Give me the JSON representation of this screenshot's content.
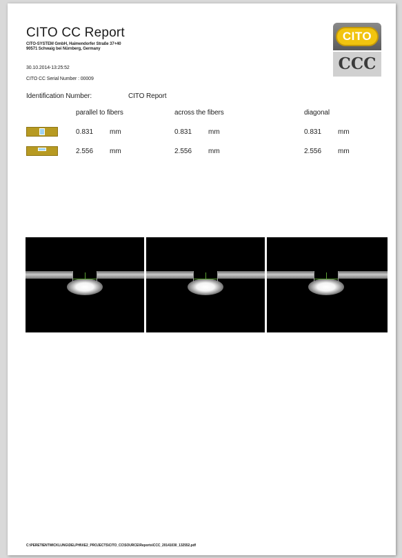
{
  "report": {
    "title": "CITO CC Report",
    "company_line1": "CITO-SYSTEM GmbH, Haimendorfer Straße 37+40",
    "company_line2": "90571 Schwaig bei Nürnberg, Germany",
    "datetime": "30.10.2014-13:25:52",
    "serial": "CITO CC Serial Number : 00009",
    "id_label": "Identification Number:",
    "id_value": "CITO Report"
  },
  "logo": {
    "top_text": "CITO",
    "bottom_text": "CCC",
    "badge_color": "#f1c40f"
  },
  "columns": [
    "parallel to fibers",
    "across the fibers",
    "diagonal"
  ],
  "rows": [
    {
      "icon": "depth-measurement-icon",
      "values": [
        "0.831",
        "0.831",
        "0.831"
      ],
      "unit": "mm"
    },
    {
      "icon": "width-measurement-icon",
      "values": [
        "2.556",
        "2.556",
        "2.556"
      ],
      "unit": "mm"
    }
  ],
  "images": [
    "parallel-to-fibers-image",
    "across-the-fibers-image",
    "diagonal-image"
  ],
  "footer": {
    "path": "C:\\PERETIENTWICKLUNG\\DELPHI\\XE2_PROJECTS\\CITO_CC\\SOURCE\\Reports\\CCC_20141030_132552.pdf"
  }
}
